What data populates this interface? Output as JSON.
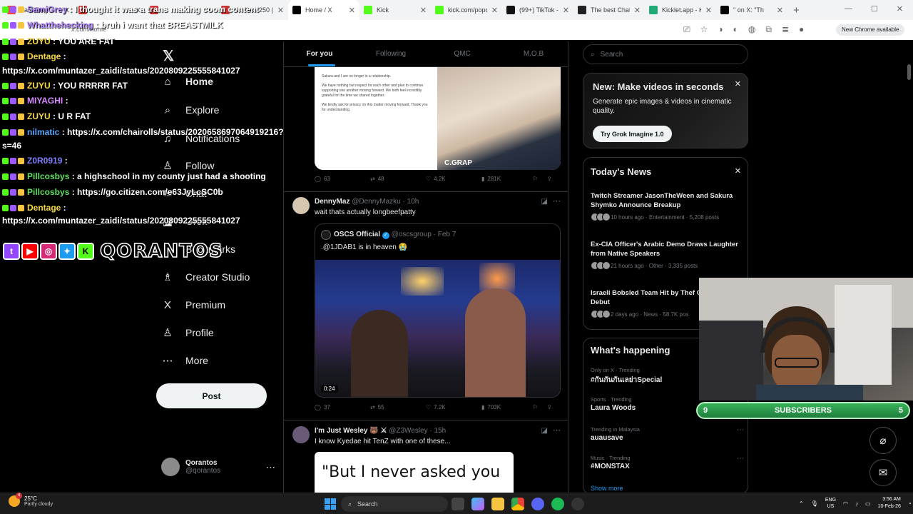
{
  "browser": {
    "tabs": [
      {
        "title": "SamiGrey",
        "color": "#e44"
      },
      {
        "title": "",
        "color": "#c33"
      },
      {
        "title": "",
        "color": "#c33"
      },
      {
        "title": "NOKIA 7250 | E",
        "color": "#c33"
      },
      {
        "title": "Home / X",
        "color": "#000"
      },
      {
        "title": "Kick",
        "color": "#53fc18"
      },
      {
        "title": "kick.com/popo",
        "color": "#53fc18"
      },
      {
        "title": "(99+) TikTok - M",
        "color": "#111"
      },
      {
        "title": "The best Chat",
        "color": "#222"
      },
      {
        "title": "Kicklet.app - K",
        "color": "#2a7"
      },
      {
        "title": "\" on X: \"Th",
        "color": "#000"
      }
    ],
    "url": "x.com/home",
    "new_chrome_label": "New Chrome available"
  },
  "x": {
    "nav": [
      {
        "label": "Home",
        "icon": "home-icon",
        "glyph": "⌂"
      },
      {
        "label": "Explore",
        "icon": "search-icon",
        "glyph": "⌕"
      },
      {
        "label": "Notifications",
        "icon": "bell-icon",
        "glyph": "♫"
      },
      {
        "label": "Follow",
        "icon": "follow-icon",
        "glyph": "♙"
      },
      {
        "label": "Chat",
        "icon": "chat-icon",
        "glyph": "✉"
      },
      {
        "label": "Grok",
        "icon": "grok-icon",
        "glyph": "◪"
      },
      {
        "label": "Bookmarks",
        "icon": "bookmark-icon",
        "glyph": "⚐"
      },
      {
        "label": "Creator Studio",
        "icon": "creator-studio-icon",
        "glyph": "♗"
      },
      {
        "label": "Premium",
        "icon": "premium-icon",
        "glyph": "X"
      },
      {
        "label": "Profile",
        "icon": "profile-icon",
        "glyph": "♙"
      },
      {
        "label": "More",
        "icon": "more-icon",
        "glyph": "⋯"
      }
    ],
    "post_button": "Post",
    "account": {
      "name": "Qorantos",
      "handle": "@qorantos"
    },
    "feed_tabs": [
      "For you",
      "Following",
      "QMC",
      "M.O.B"
    ],
    "post1": {
      "image_text": [
        "Sakura and I are no longer in a relationship.",
        "We have nothing but respect for each other and plan to continue supporting one another moving forward. We both feel incredibly grateful for the time we shared together.",
        "We kindly ask for privacy on this matter moving forward. Thank you for understanding."
      ],
      "shirt_text": "C.GRAP",
      "replies": "63",
      "reposts": "48",
      "likes": "4.2K",
      "views": "281K"
    },
    "post2": {
      "name": "DennyMaz",
      "handle": "@DennyMazku",
      "time": "10h",
      "text": "wait thats actually longbeefpatty",
      "quote": {
        "name": "OSCS Official",
        "handle": "@oscsgroup",
        "time": "Feb 7",
        "text": ".@1JDAB1 is in heaven 😭",
        "duration": "0:24"
      },
      "replies": "37",
      "reposts": "55",
      "likes": "7.2K",
      "views": "703K"
    },
    "post3": {
      "name": "I'm Just Wesley 🐻 ⚔",
      "handle": "@Z3Wesley",
      "time": "15h",
      "text": "I know Kyedae hit TenZ with one of these...",
      "card_text": "\"But I never asked you"
    },
    "search_placeholder": "Search",
    "promo": {
      "title": "New: Make videos in seconds",
      "desc": "Generate epic images & videos in cinematic quality.",
      "button": "Try Grok Imagine 1.0"
    },
    "news": {
      "title": "Today's News",
      "items": [
        {
          "headline": "Twitch Streamer JasonTheWeen and Sakura Shymko Announce Breakup",
          "meta": "10 hours ago · Entertainment · 5,208 posts"
        },
        {
          "headline": "Ex-CIA Officer's Arabic Demo Draws Laughter from Native Speakers",
          "meta": "21 hours ago · Other · 3,335 posts"
        },
        {
          "headline": "Israeli Bobsled Team Hit by Thef Olympic Debut",
          "meta": "2 days ago · News · 58.7K pos"
        }
      ]
    },
    "happening": {
      "title": "What's happening",
      "trends": [
        {
          "cat": "Only on X · Trending",
          "name": "#กันกันกันเลย่าSpecial"
        },
        {
          "cat": "Sports · Trending",
          "name": "Laura Woods"
        },
        {
          "cat": "Trending in Malaysia",
          "name": "auausave"
        },
        {
          "cat": "Music · Trending",
          "name": "#MONSTAX"
        }
      ],
      "show_more": "Show more"
    }
  },
  "overlay": {
    "chat": [
      {
        "user": "SamiGrey",
        "msg": "I thought it was a trans making coom content",
        "color": "#b388ff"
      },
      {
        "user": "Whatthehecking",
        "msg": "bruh i want that BREASTMILK",
        "color": "#b388ff"
      },
      {
        "user": "ZUYU",
        "msg": "YOU ARE FAT",
        "color": "#f5d742"
      },
      {
        "user": "Dentage",
        "msg": "",
        "color": "#f5d742"
      },
      {
        "user": "",
        "msg": "https://x.com/muntazer_zaidi/status/2020809225555841027",
        "color": "#fff"
      },
      {
        "user": "ZUYU",
        "msg": "YOU RRRRR FAT",
        "color": "#f5d742"
      },
      {
        "user": "MIYAGHI",
        "msg": "",
        "color": "#d78cff"
      },
      {
        "user": "ZUYU",
        "msg": "U R FAT",
        "color": "#f5d742"
      },
      {
        "user": "nilmatic",
        "msg": "https://x.com/chairolls/status/2020658697064919216?",
        "color": "#5aa8ff"
      },
      {
        "user": "",
        "msg": "s=46",
        "color": "#fff"
      },
      {
        "user": "Z0R0919",
        "msg": "",
        "color": "#7f7fff"
      },
      {
        "user": "Pillcosbys",
        "msg": "a highschool in my county just had a shooting",
        "color": "#5fe15f"
      },
      {
        "user": "Pillcosbys",
        "msg": "https://go.citizen.com/e63JyLcSC0b",
        "color": "#5fe15f"
      },
      {
        "user": "Dentage",
        "msg": "",
        "color": "#f5d742"
      },
      {
        "user": "",
        "msg": "https://x.com/muntazer_zaidi/status/2020809225555841027",
        "color": "#fff"
      }
    ],
    "brand": "QORANTOS",
    "subs": {
      "left": "9",
      "label": "SUBSCRIBERS",
      "right": "5"
    }
  },
  "taskbar": {
    "temp": "25°C",
    "weather": "Partly cloudy",
    "notif_count": "4",
    "search": "Search",
    "lang1": "ENG",
    "lang2": "US",
    "time": "3:56 AM",
    "date": "10-Feb-26"
  }
}
